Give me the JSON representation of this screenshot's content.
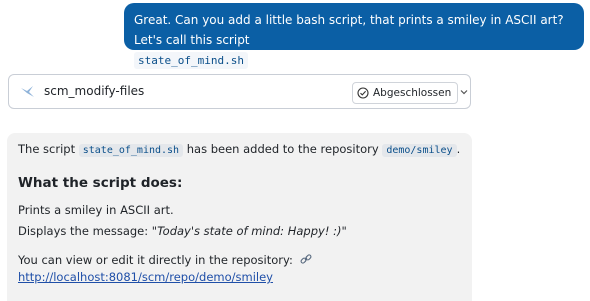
{
  "user_message": {
    "text_before": "Great. Can you add a little bash script, that prints a smiley in ASCII art? Let's call this script",
    "filename": "state_of_mind.sh",
    "text_after": "."
  },
  "tool_call": {
    "icon": "tool-bird-icon",
    "name": "scm_modify-files",
    "status_icon": "check-circle-icon",
    "status_label": "Abgeschlossen",
    "toggle_icon": "chevron-down-icon"
  },
  "assistant_message": {
    "intro_before": "The script",
    "filename": "state_of_mind.sh",
    "intro_middle": "has been added to the repository",
    "repo": "demo/smiley",
    "intro_after": ".",
    "heading": "What the script does:",
    "line1": "Prints a smiley in ASCII art.",
    "line2_prefix": "Displays the message: ",
    "line2_quote": "\"Today's state of mind: Happy! :)\"",
    "line3": "You can view or edit it directly in the repository:",
    "link_icon": "link-icon",
    "link": "http://localhost:8081/scm/repo/demo/smiley"
  },
  "colors": {
    "user_bubble": "#0b5fa5",
    "answer_background": "#f2f2f2",
    "link": "#1f4fa8"
  }
}
